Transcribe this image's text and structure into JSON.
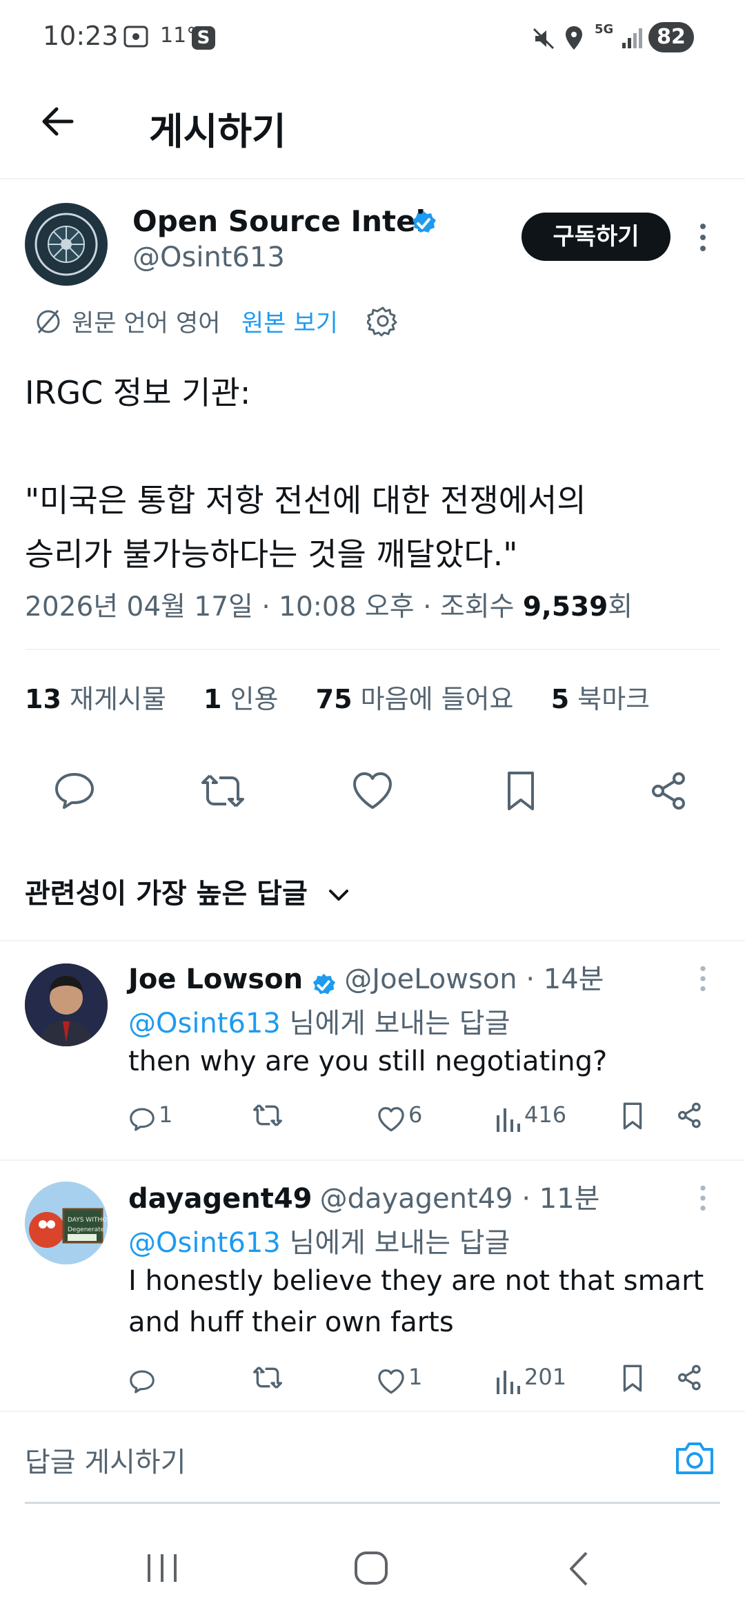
{
  "status_bar": {
    "time": "10:23",
    "temperature": "11°",
    "battery": "82"
  },
  "header": {
    "title": "게시하기"
  },
  "post": {
    "author_name": "Open Source Intel",
    "author_handle": "@Osint613",
    "subscribe_label": "구독하기",
    "translation_note": "원문 언어 영어",
    "view_original_label": "원본 보기",
    "text_line1": "IRGC 정보 기관:",
    "text_line2": "\"미국은 통합 저항 전선에 대한 전쟁에서의",
    "text_line3": "승리가 불가능하다는 것을 깨달았다.\"",
    "meta_prefix": "2026년 04월 17일 · 10:08 오후 · 조회수 ",
    "views": "9,539",
    "views_suffix": "회",
    "stats": {
      "reposts_count": "13",
      "reposts_label": "재게시물",
      "quotes_count": "1",
      "quotes_label": "인용",
      "likes_count": "75",
      "likes_label": "마음에 들어요",
      "bookmarks_count": "5",
      "bookmarks_label": "북마크"
    }
  },
  "replies_header": {
    "sort_label": "관련성이 가장 높은 답글"
  },
  "replies": [
    {
      "name": "Joe Lowson",
      "handle_time": "@JoeLowson · 14분",
      "reply_to_handle": "@Osint613",
      "reply_to_suffix": " 님에게 보내는 답글",
      "text_line1": "then why are you still negotiating?",
      "text_line2": "",
      "replies": "1",
      "likes": "6",
      "views": "416"
    },
    {
      "name": "dayagent49",
      "handle_time": "@dayagent49 · 11분",
      "reply_to_handle": "@Osint613",
      "reply_to_suffix": " 님에게 보내는 답글",
      "text_line1": "I honestly believe they are not that smart",
      "text_line2": "and huff their own farts",
      "replies": "",
      "likes": "1",
      "views": "201"
    }
  ],
  "composer": {
    "placeholder": "답글 게시하기"
  },
  "colors": {
    "accent": "#1d9bf0",
    "text": "#0f1419",
    "muted": "#536471"
  }
}
